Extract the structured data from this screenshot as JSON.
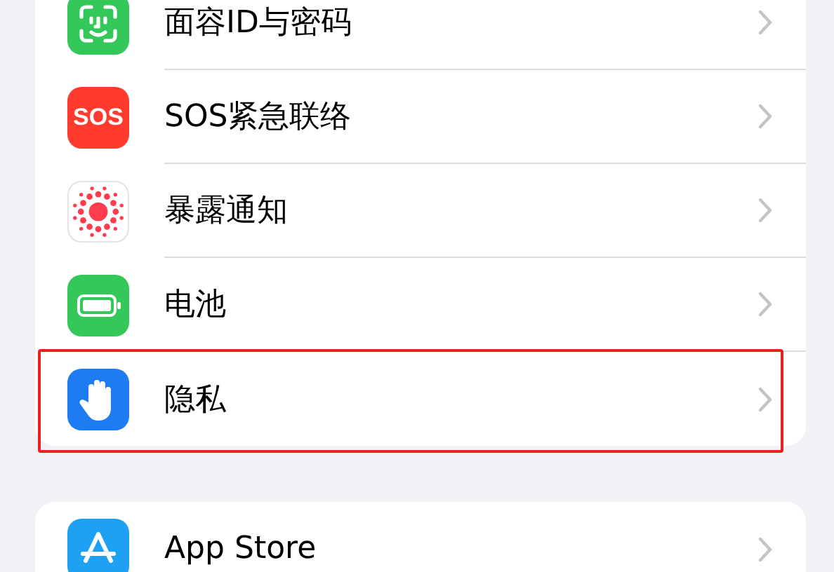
{
  "groups": [
    {
      "items": [
        {
          "label": "面容ID与密码",
          "kind": "face",
          "highlighted": false
        },
        {
          "label": "SOS紧急联络",
          "kind": "sos",
          "icon_text": "SOS",
          "highlighted": false
        },
        {
          "label": "暴露通知",
          "kind": "exposure",
          "highlighted": false
        },
        {
          "label": "电池",
          "kind": "battery",
          "highlighted": false
        },
        {
          "label": "隐私",
          "kind": "privacy",
          "highlighted": true
        }
      ]
    },
    {
      "items": [
        {
          "label": "App Store",
          "kind": "store",
          "highlighted": false
        }
      ]
    }
  ]
}
